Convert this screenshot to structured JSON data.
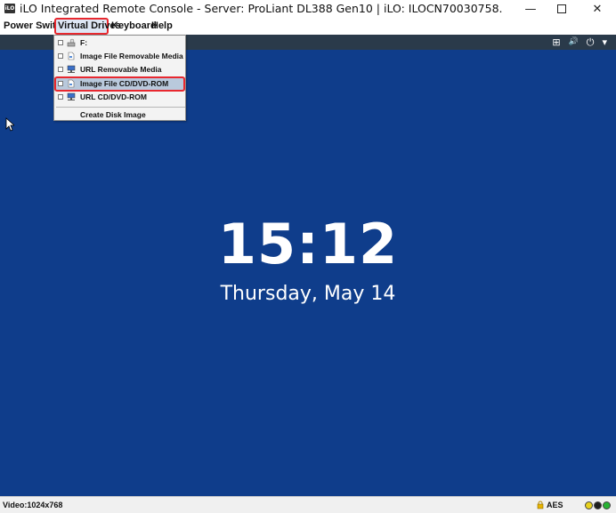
{
  "window": {
    "title": "iLO Integrated Remote Console - Server: ProLiant DL388 Gen10 | iLO: ILOCN70030758.",
    "app_icon_text": "iLO",
    "minimize_glyph": "—",
    "close_glyph": "✕"
  },
  "menubar": {
    "items": [
      {
        "label": "Power Switch"
      },
      {
        "label": "Virtual Drives",
        "highlighted": true
      },
      {
        "label": "Keyboard"
      },
      {
        "label": "Help"
      }
    ]
  },
  "toolbar": {
    "icons": [
      "network-icon",
      "speaker-icon",
      "power-icon",
      "chevron-down-icon"
    ],
    "glyphs": {
      "network": "⊞",
      "speaker": "🔊",
      "power": "⏻",
      "chevron": "▾"
    }
  },
  "virtual_drives_menu": {
    "items": [
      {
        "label": "F:",
        "icon": "drive-icon",
        "checked": false
      },
      {
        "label": "Image File Removable Media",
        "icon": "file-icon",
        "checked": false
      },
      {
        "label": "URL Removable Media",
        "icon": "network-drive-icon",
        "checked": false
      },
      {
        "label": "Image File CD/DVD-ROM",
        "icon": "file-icon",
        "checked": false,
        "selected": true
      },
      {
        "label": "URL CD/DVD-ROM",
        "icon": "network-drive-icon",
        "checked": false
      },
      {
        "label": "Create Disk Image",
        "icon": "",
        "checked": false
      }
    ]
  },
  "screen": {
    "background": "#0f3d8b",
    "clock": "15:12",
    "date": "Thursday, May 14"
  },
  "statusbar": {
    "video": "Video:1024x768",
    "encryption": "AES",
    "leds": [
      "#e8d21d",
      "#1f1f1f",
      "#27b233"
    ]
  },
  "colors": {
    "highlight_box": "#e8282f",
    "selected_item": "#b9c9dc",
    "toolstrip": "#2a3a4a"
  }
}
